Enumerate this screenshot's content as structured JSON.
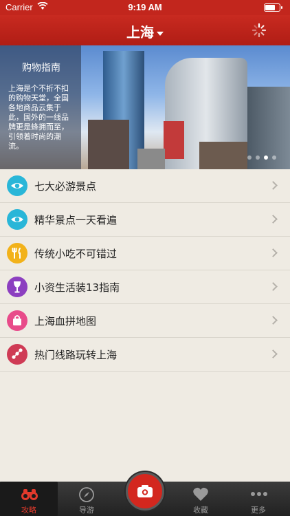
{
  "status_bar": {
    "carrier": "Carrier",
    "time": "9:19 AM"
  },
  "nav": {
    "title": "上海"
  },
  "banner": {
    "title": "购物指南",
    "description": "上海是个不折不扣的购物天堂，全国各地商品云集于此，国外的一线品牌更是蜂拥而至，引领着时尚的潮流。",
    "page_count": 4,
    "active_page": 3
  },
  "list": [
    {
      "label": "七大必游景点",
      "icon": "eye-icon",
      "color": "#29b6d8"
    },
    {
      "label": "精华景点一天看遍",
      "icon": "eye-icon",
      "color": "#29b6d8"
    },
    {
      "label": "传统小吃不可错过",
      "icon": "utensils-icon",
      "color": "#f2b21a"
    },
    {
      "label": "小资生活装13指南",
      "icon": "wine-glass-icon",
      "color": "#8c3fc0"
    },
    {
      "label": "上海血拼地图",
      "icon": "shopping-bag-icon",
      "color": "#e84b8a"
    },
    {
      "label": "热门线路玩转上海",
      "icon": "route-icon",
      "color": "#cf3b55"
    }
  ],
  "tabbar": {
    "tabs": [
      {
        "label": "攻略",
        "icon": "binoculars-icon",
        "active": true
      },
      {
        "label": "导游",
        "icon": "compass-icon",
        "active": false
      },
      {
        "label": "收藏",
        "icon": "heart-icon",
        "active": false
      },
      {
        "label": "更多",
        "icon": "more-icon",
        "active": false
      }
    ],
    "center": {
      "icon": "camera-icon"
    }
  },
  "colors": {
    "brand": "#c2261d",
    "background": "#efebe3",
    "tab_active": "#e23a2c"
  }
}
